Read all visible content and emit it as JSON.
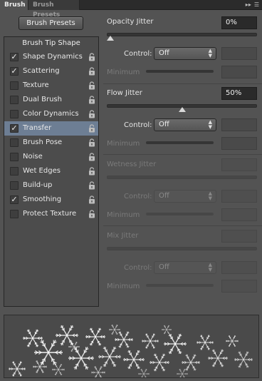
{
  "tabs": {
    "active": "Brush",
    "inactive": "Brush Presets"
  },
  "tabbar_icons": [
    "panel-collapse-icon",
    "panel-menu-icon"
  ],
  "presets_button": "Brush Presets",
  "list": {
    "header": "Brush Tip Shape",
    "items": [
      {
        "label": "Shape Dynamics",
        "checked": true
      },
      {
        "label": "Scattering",
        "checked": true
      },
      {
        "label": "Texture",
        "checked": false
      },
      {
        "label": "Dual Brush",
        "checked": false
      },
      {
        "label": "Color Dynamics",
        "checked": false
      },
      {
        "label": "Transfer",
        "checked": true,
        "selected": true
      },
      {
        "label": "Brush Pose",
        "checked": false
      },
      {
        "label": "Noise",
        "checked": false
      },
      {
        "label": "Wet Edges",
        "checked": false
      },
      {
        "label": "Build-up",
        "checked": false
      },
      {
        "label": "Smoothing",
        "checked": true
      },
      {
        "label": "Protect Texture",
        "checked": false
      }
    ]
  },
  "settings": {
    "opacity_jitter": {
      "label": "Opacity Jitter",
      "value": "0%",
      "level": 0
    },
    "opacity_control": {
      "label": "Control:",
      "value": "Off",
      "min_label": "Minimum"
    },
    "flow_jitter": {
      "label": "Flow Jitter",
      "value": "50%",
      "level": 0.5
    },
    "flow_control": {
      "label": "Control:",
      "value": "Off",
      "min_label": "Minimum"
    },
    "wetness_jitter": {
      "label": "Wetness Jitter"
    },
    "wetness_control": {
      "label": "Control:",
      "value": "Off",
      "min_label": "Minimum"
    },
    "mix_jitter": {
      "label": "Mix Jitter"
    },
    "mix_control": {
      "label": "Control:",
      "value": "Off",
      "min_label": "Minimum"
    }
  },
  "colors": {
    "panel": "#535353",
    "selected_row": "#6d7e94",
    "field": "#2a2a2a"
  }
}
